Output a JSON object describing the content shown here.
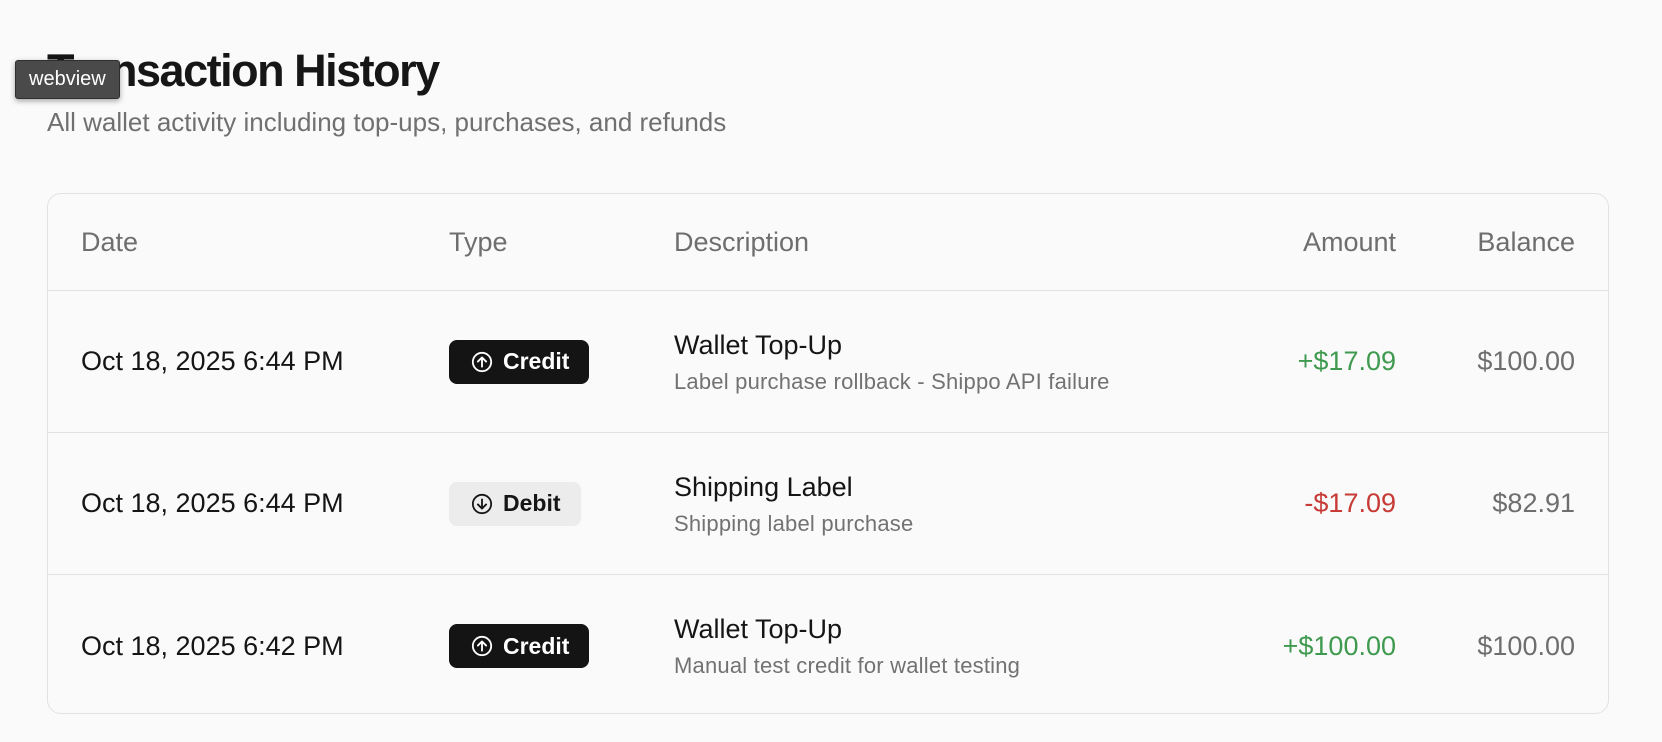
{
  "tooltip": "webview",
  "header": {
    "title": "Transaction History",
    "subtitle": "All wallet activity including top-ups, purchases, and refunds"
  },
  "table": {
    "columns": {
      "date": "Date",
      "type": "Type",
      "description": "Description",
      "amount": "Amount",
      "balance": "Balance"
    },
    "rows": [
      {
        "date": "Oct 18, 2025 6:44 PM",
        "type": "Credit",
        "type_icon": "arrow-up-circle-icon",
        "title": "Wallet Top-Up",
        "subtitle": "Label purchase rollback - Shippo API failure",
        "amount": "+$17.09",
        "balance": "$100.00"
      },
      {
        "date": "Oct 18, 2025 6:44 PM",
        "type": "Debit",
        "type_icon": "arrow-down-circle-icon",
        "title": "Shipping Label",
        "subtitle": "Shipping label purchase",
        "amount": "-$17.09",
        "balance": "$82.91"
      },
      {
        "date": "Oct 18, 2025 6:42 PM",
        "type": "Credit",
        "type_icon": "arrow-up-circle-icon",
        "title": "Wallet Top-Up",
        "subtitle": "Manual test credit for wallet testing",
        "amount": "+$100.00",
        "balance": "$100.00"
      }
    ]
  },
  "colors": {
    "positive": "#3f9a4f",
    "negative": "#c73a35",
    "credit_badge_bg": "#141414",
    "debit_badge_bg": "#ececec"
  }
}
